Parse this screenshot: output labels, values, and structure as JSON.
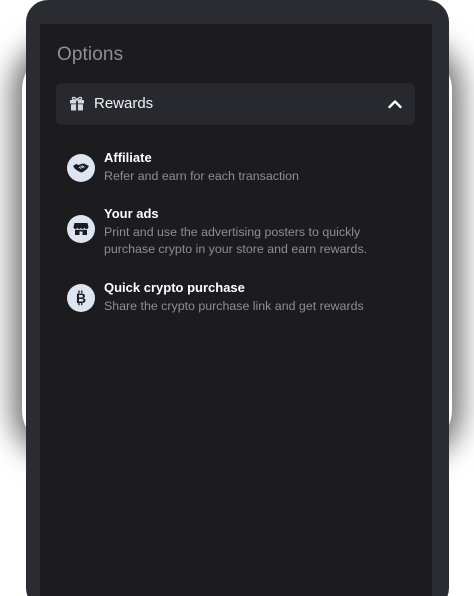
{
  "panel": {
    "title": "Options"
  },
  "accordion": {
    "label": "Rewards",
    "icon": "gift-icon",
    "expanded": true
  },
  "items": [
    {
      "icon": "handshake-icon",
      "title": "Affiliate",
      "description": "Refer and earn for each transaction"
    },
    {
      "icon": "store-icon",
      "title": "Your ads",
      "description": "Print and use the advertising posters to quickly purchase crypto in your store and earn rewards."
    },
    {
      "icon": "bitcoin-icon",
      "title": "Quick crypto purchase",
      "description": "Share the crypto purchase link and get rewards"
    }
  ],
  "colors": {
    "panel_bg": "#1c1c1f",
    "accordion_bg": "#28282f",
    "icon_badge": "#dde6f0",
    "icon_fg": "#1c1c1f"
  }
}
